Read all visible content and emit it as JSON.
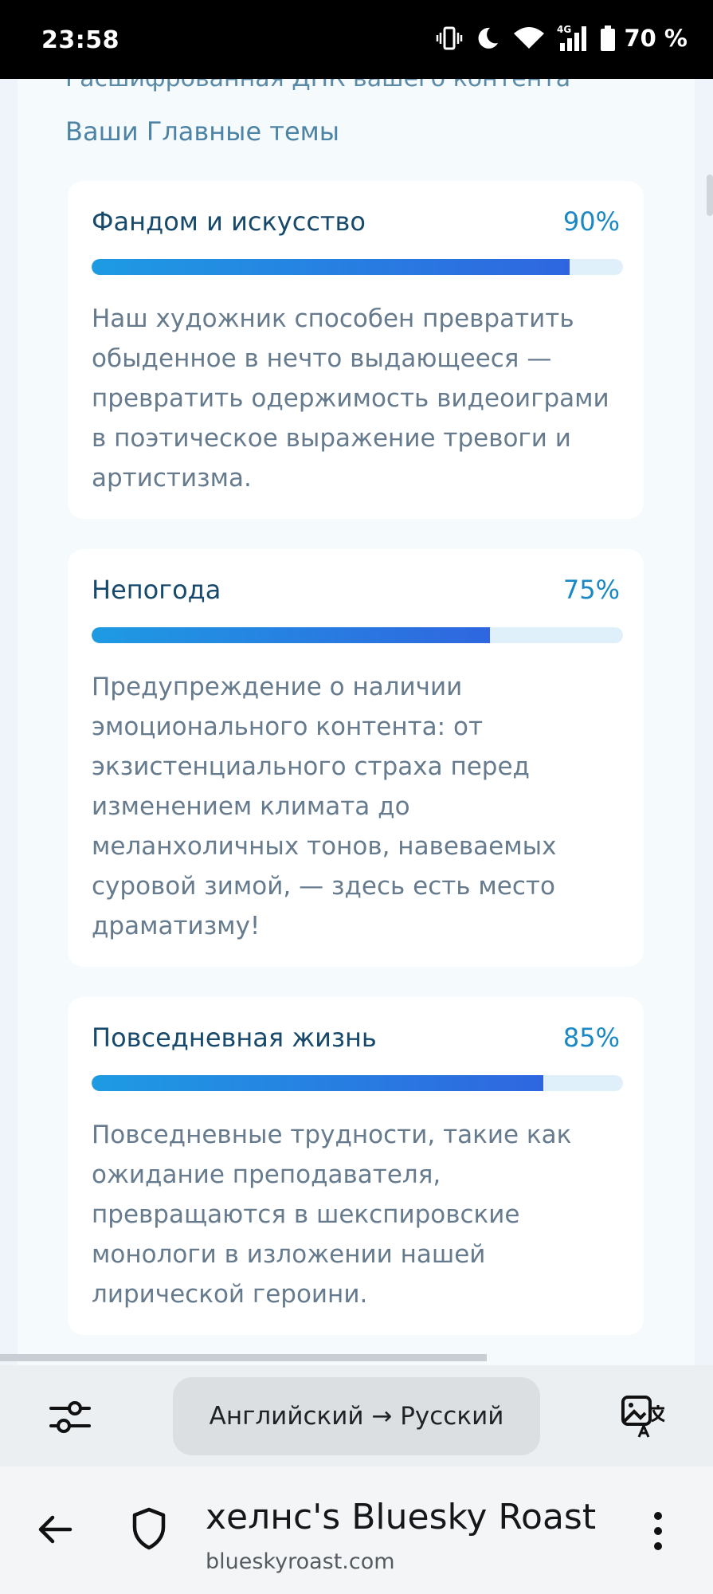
{
  "status_bar": {
    "time": "23:58",
    "network": "4G",
    "battery": "70 %",
    "icons": [
      "vibrate-icon",
      "moon-icon",
      "wifi-icon",
      "signal-icon",
      "battery-icon"
    ]
  },
  "page": {
    "cut_text": "Расшифрованная ДНК вашего контента",
    "section_title": "Ваши Главные темы",
    "topics": [
      {
        "title": "Фандом и искусство",
        "percent_label": "90%",
        "percent": 90,
        "description": "Наш художник способен превратить обыденное в нечто выдающееся — превратить одержимость видеоиграми в поэтическое выражение тревоги и артистизма."
      },
      {
        "title": "Непогода",
        "percent_label": "75%",
        "percent": 75,
        "description": "Предупреждение о наличии эмоционального контента: от экзистенциального страха перед изменением климата до меланхоличных тонов, навеваемых суровой зимой, — здесь есть место драматизму!"
      },
      {
        "title": "Повседневная жизнь",
        "percent_label": "85%",
        "percent": 85,
        "description": "Повседневные трудности, такие как ожидание преподавателя, превращаются в шекспировские монологи в изложении нашей лирической героини."
      }
    ]
  },
  "translate_bar": {
    "language_pair": "Английский → Русский",
    "left_icon": "settings-sliders-icon",
    "right_icon": "image-translate-icon"
  },
  "url_bar": {
    "title": "хелнс's Bluesky Roast",
    "domain": "blueskyroast.com"
  },
  "colors": {
    "accent": "#1a88c4",
    "title": "#16496b",
    "bar_start": "#1e9be3",
    "bar_end": "#2f66e0",
    "bar_track": "#dff0fb"
  }
}
